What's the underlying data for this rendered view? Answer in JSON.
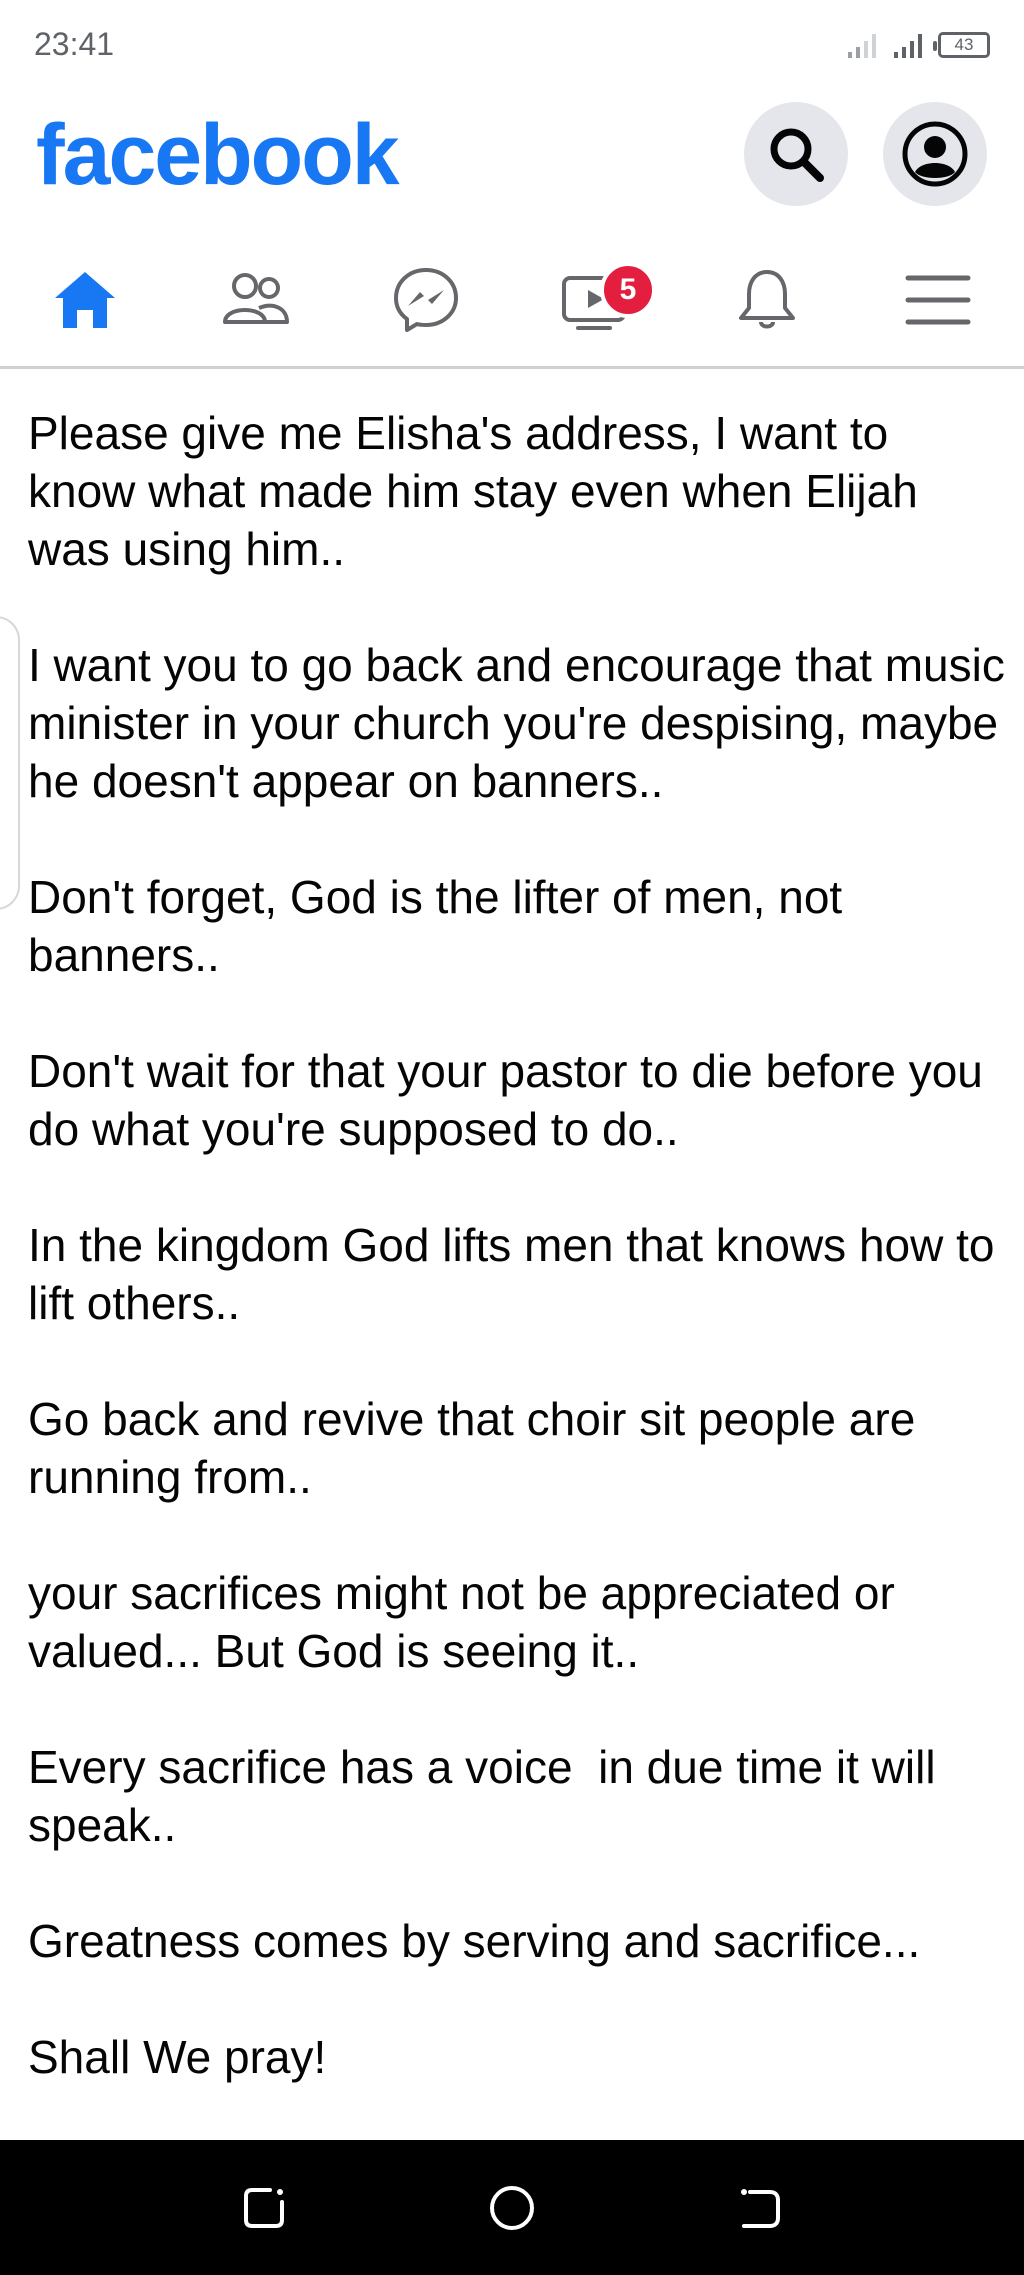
{
  "status_bar": {
    "time": "23:41",
    "battery": "43"
  },
  "header": {
    "logo": "facebook",
    "search_icon": "search-icon",
    "profile_icon": "profile-icon"
  },
  "nav": {
    "items": [
      {
        "name": "home",
        "icon": "home-icon",
        "active": true
      },
      {
        "name": "friends",
        "icon": "friends-icon"
      },
      {
        "name": "messenger",
        "icon": "messenger-icon"
      },
      {
        "name": "watch",
        "icon": "video-icon",
        "badge": "5"
      },
      {
        "name": "notifications",
        "icon": "bell-icon"
      },
      {
        "name": "menu",
        "icon": "menu-icon"
      }
    ]
  },
  "post": {
    "paragraphs": [
      "Please give me Elisha's address, I want to know what made him stay even when Elijah was using him..",
      "I want you to go back and encourage that music minister in your church you're despising, maybe he doesn't appear on banners..",
      "Don't forget, God is the lifter of men, not banners..",
      "Don't wait for that your pastor to die before you do what you're supposed to do..",
      "In the kingdom God lifts men that knows how to lift others..",
      "Go back and revive that choir sit people are running from..",
      "your sacrifices might not be appreciated or valued... But God is seeing it..",
      "Every sacrifice has a voice  in due time it will speak..",
      "Greatness comes by serving and sacrifice...",
      "Shall We pray!"
    ]
  },
  "colors": {
    "brand": "#1877f2",
    "badge": "#e41e3f",
    "icon_gray": "#65676b"
  }
}
